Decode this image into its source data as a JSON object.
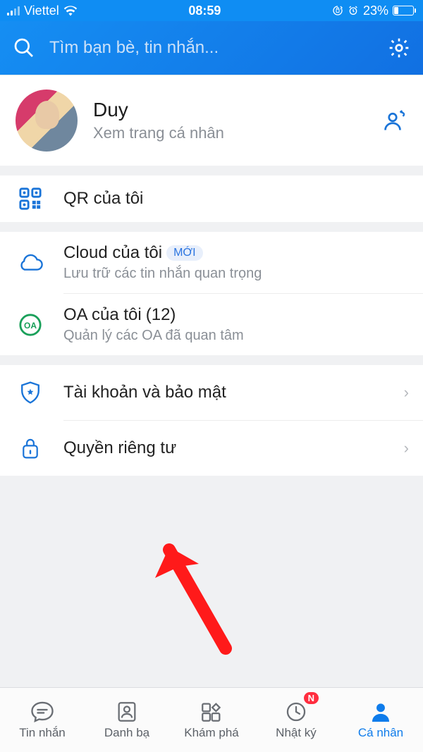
{
  "status": {
    "carrier": "Viettel",
    "time": "08:59",
    "battery_pct": "23%"
  },
  "header": {
    "search_placeholder": "Tìm bạn bè, tin nhắn..."
  },
  "profile": {
    "name": "Duy",
    "subtitle": "Xem trang cá nhân"
  },
  "rows": {
    "qr": {
      "title": "QR của tôi"
    },
    "cloud": {
      "title": "Cloud của tôi",
      "badge": "MỚI",
      "sub": "Lưu trữ các tin nhắn quan trọng"
    },
    "oa": {
      "title": "OA của tôi",
      "count": "(12)",
      "sub": "Quản lý các OA đã quan tâm"
    },
    "security": {
      "title": "Tài khoản và bảo mật"
    },
    "privacy": {
      "title": "Quyền riêng tư"
    }
  },
  "tabs": {
    "messages": "Tin nhắn",
    "contacts": "Danh bạ",
    "discover": "Khám phá",
    "timeline": "Nhật ký",
    "timeline_badge": "N",
    "me": "Cá nhân"
  }
}
